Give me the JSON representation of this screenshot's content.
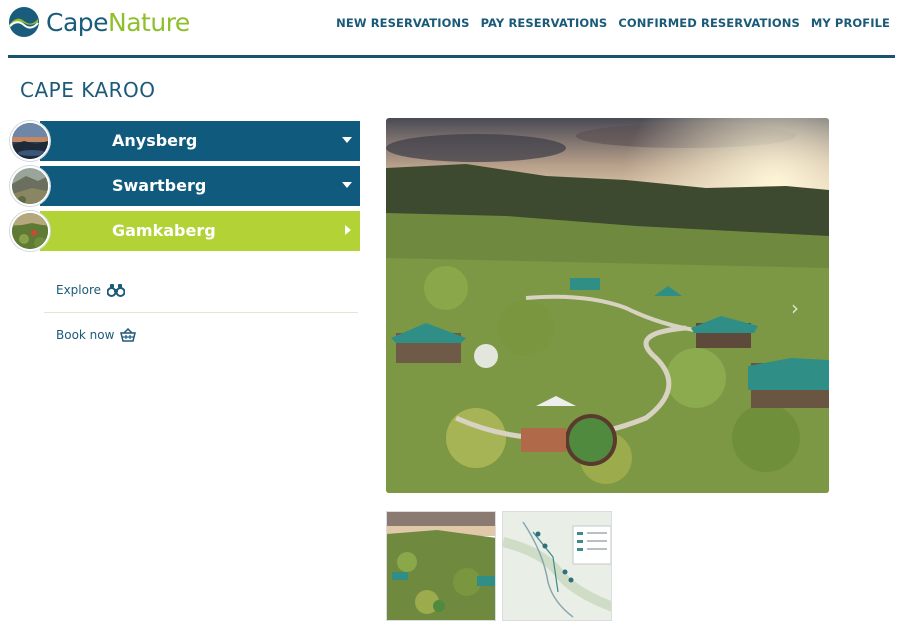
{
  "brand": {
    "part1": "Cape",
    "part2": "Nature"
  },
  "nav": {
    "items": [
      "NEW RESERVATIONS",
      "PAY RESERVATIONS",
      "CONFIRMED RESERVATIONS",
      "MY PROFILE"
    ]
  },
  "page": {
    "title": "CAPE KAROO"
  },
  "reserves": [
    {
      "label": "Anysberg",
      "state": "collapsed",
      "color": "#0f5a7d"
    },
    {
      "label": "Swartberg",
      "state": "collapsed",
      "color": "#0f5a7d"
    },
    {
      "label": "Gamkaberg",
      "state": "selected",
      "color": "#b2d236"
    }
  ],
  "actions": {
    "explore": "Explore",
    "explore_icon": "binoculars-icon",
    "book_now": "Book now",
    "book_icon": "basket-icon"
  },
  "gallery": {
    "main_image": "aerial-camp-photo",
    "next_icon": "chevron-right-icon",
    "thumbnails": [
      "aerial-camp-thumbnail",
      "map-thumbnail"
    ]
  },
  "colors": {
    "primary": "#0f5a7d",
    "accent": "#b2d236",
    "text": "#1d5a7a"
  }
}
